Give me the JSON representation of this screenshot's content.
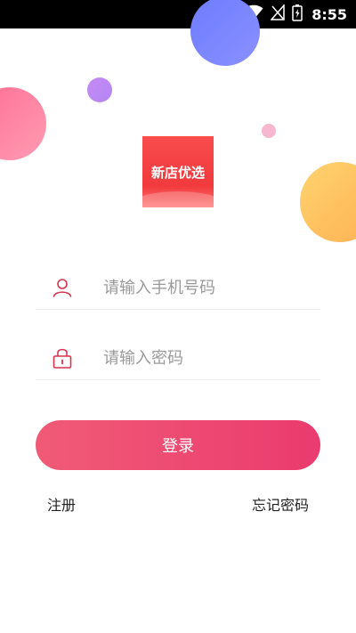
{
  "status_bar": {
    "time": "8:55",
    "icons": [
      "wifi-icon",
      "sim-signal-icon",
      "battery-icon"
    ]
  },
  "logo": {
    "text": "新店优选"
  },
  "form": {
    "phone": {
      "placeholder": "请输入手机号码",
      "value": "",
      "icon": "user-icon"
    },
    "password": {
      "placeholder": "请输入密码",
      "value": "",
      "icon": "lock-icon"
    },
    "login_label": "登录"
  },
  "links": {
    "register": "注册",
    "forgot_password": "忘记密码"
  },
  "colors": {
    "accent_start": "#f15b77",
    "accent_end": "#ea3b6e",
    "logo_red": "#f13a3d",
    "icon_red": "#d9344f"
  }
}
